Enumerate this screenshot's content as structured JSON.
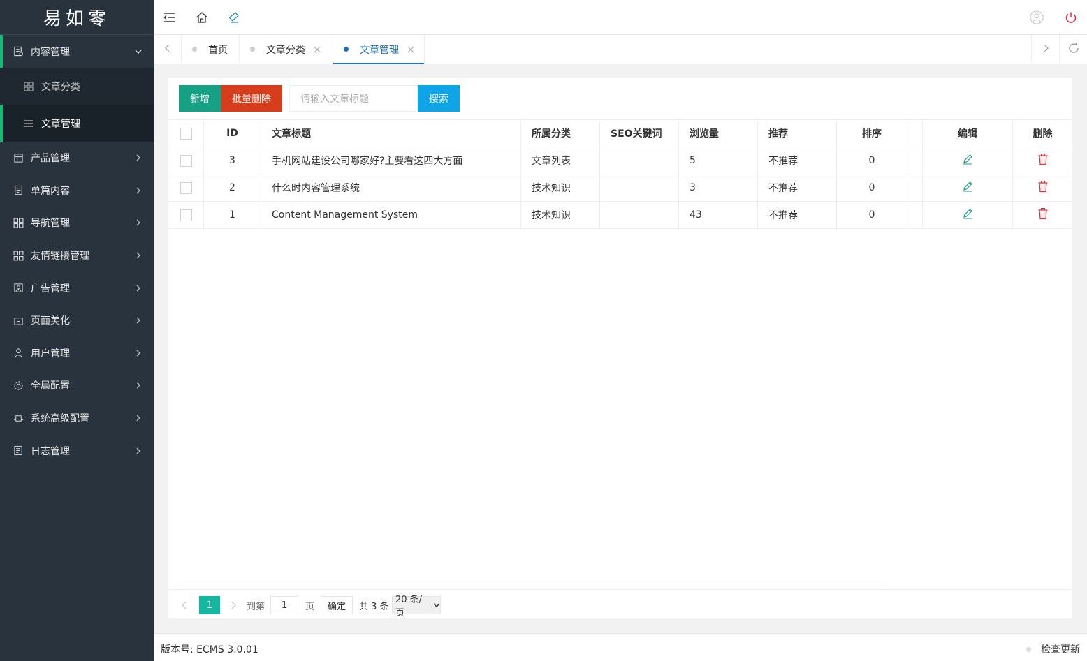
{
  "sidebar": {
    "logo": "易如零",
    "items": [
      {
        "label": "内容管理",
        "icon": "document-icon"
      },
      {
        "label": "产品管理",
        "icon": "product-icon"
      },
      {
        "label": "单篇内容",
        "icon": "page-icon"
      },
      {
        "label": "导航管理",
        "icon": "grid-icon"
      },
      {
        "label": "友情链接管理",
        "icon": "grid-icon"
      },
      {
        "label": "广告管理",
        "icon": "image-icon"
      },
      {
        "label": "页面美化",
        "icon": "store-icon"
      },
      {
        "label": "用户管理",
        "icon": "user-icon"
      },
      {
        "label": "全局配置",
        "icon": "gear-icon"
      },
      {
        "label": "系统高级配置",
        "icon": "chip-icon"
      },
      {
        "label": "日志管理",
        "icon": "log-icon"
      }
    ],
    "sub_items": [
      {
        "label": "文章分类",
        "icon": "grid-icon"
      },
      {
        "label": "文章管理",
        "icon": "list-icon"
      }
    ]
  },
  "tabs": [
    {
      "label": "首页"
    },
    {
      "label": "文章分类"
    },
    {
      "label": "文章管理"
    }
  ],
  "toolbar": {
    "add_label": "新增",
    "batch_delete_label": "批量删除",
    "search_placeholder": "请输入文章标题",
    "search_label": "搜索"
  },
  "table": {
    "headers": {
      "id": "ID",
      "title": "文章标题",
      "category": "所属分类",
      "seo": "SEO关键词",
      "views": "浏览量",
      "recommend": "推荐",
      "sort": "排序",
      "edit": "编辑",
      "delete": "删除"
    },
    "rows": [
      {
        "id": "3",
        "title": "手机网站建设公司哪家好?主要看这四大方面",
        "category": "文章列表",
        "seo": "",
        "views": "5",
        "recommend": "不推荐",
        "sort": "0"
      },
      {
        "id": "2",
        "title": "什么时内容管理系统",
        "category": "技术知识",
        "seo": "",
        "views": "3",
        "recommend": "不推荐",
        "sort": "0"
      },
      {
        "id": "1",
        "title": "Content Management System",
        "category": "技术知识",
        "seo": "",
        "views": "43",
        "recommend": "不推荐",
        "sort": "0"
      }
    ]
  },
  "pager": {
    "current": "1",
    "goto_label": "到第",
    "page_value": "1",
    "page_unit": "页",
    "confirm_label": "确定",
    "total_label": "共 3 条",
    "page_size": "20 条/页"
  },
  "footer": {
    "version": "版本号: ECMS 3.0.01",
    "check_update": "检查更新"
  },
  "colors": {
    "sidebar_bg": "#28333e",
    "accent_green": "#16b777",
    "add_btn": "#16a185",
    "delete_btn": "#d63d1b",
    "search_btn": "#0ea4e6",
    "active_tab": "#1e6fb8"
  }
}
